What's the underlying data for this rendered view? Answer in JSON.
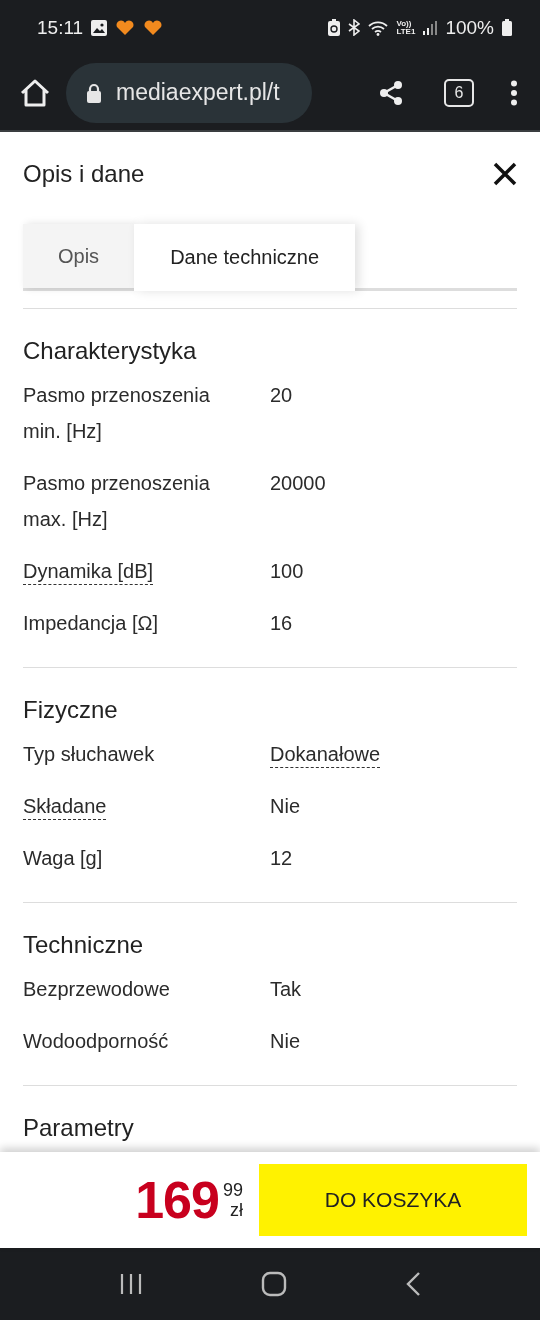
{
  "status_bar": {
    "time": "15:11",
    "network": [
      "Vo))",
      "LTE1"
    ],
    "battery": "100%"
  },
  "browser": {
    "url": "mediaexpert.pl/t",
    "tab_count": "6"
  },
  "panel": {
    "title": "Opis i dane",
    "tabs": [
      {
        "label": "Opis",
        "selected": false
      },
      {
        "label": "Dane techniczne",
        "selected": true
      }
    ],
    "sections": [
      {
        "title": "Charakterystyka",
        "rows": [
          {
            "label": "Pasmo przenoszenia min. [Hz]",
            "value": "20",
            "label_hint": false,
            "value_hint": false
          },
          {
            "label": "Pasmo przenoszenia max. [Hz]",
            "value": "20000",
            "label_hint": false,
            "value_hint": false
          },
          {
            "label": "Dynamika [dB]",
            "value": "100",
            "label_hint": true,
            "value_hint": false
          },
          {
            "label": "Impedancja [Ω]",
            "value": "16",
            "label_hint": false,
            "value_hint": false
          }
        ]
      },
      {
        "title": "Fizyczne",
        "rows": [
          {
            "label": "Typ słuchawek",
            "value": "Dokanałowe",
            "label_hint": false,
            "value_hint": true
          },
          {
            "label": "Składane",
            "value": "Nie",
            "label_hint": true,
            "value_hint": false
          },
          {
            "label": "Waga [g]",
            "value": "12",
            "label_hint": false,
            "value_hint": false
          }
        ]
      },
      {
        "title": "Techniczne",
        "rows": [
          {
            "label": "Bezprzewodowe",
            "value": "Tak",
            "label_hint": false,
            "value_hint": false
          },
          {
            "label": "Wodoodporność",
            "value": "Nie",
            "label_hint": false,
            "value_hint": false
          }
        ]
      },
      {
        "title": "Parametry"
      }
    ]
  },
  "buy_bar": {
    "price_main": "169",
    "price_cents": "99",
    "currency": "zł",
    "button": "DO KOSZYKA"
  }
}
